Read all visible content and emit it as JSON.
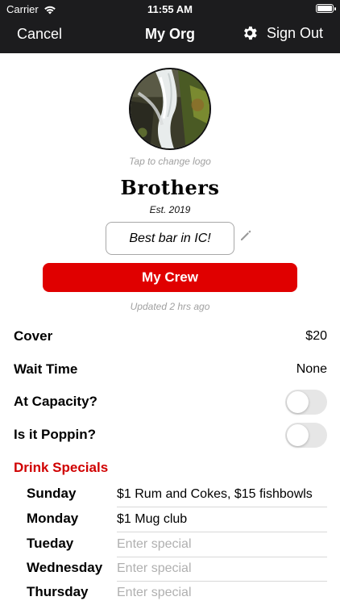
{
  "status_bar": {
    "carrier": "Carrier",
    "time": "11:55 AM"
  },
  "nav": {
    "cancel": "Cancel",
    "title": "My Org",
    "sign_out": "Sign Out"
  },
  "profile": {
    "logo_hint": "Tap to change logo",
    "name": "Brothers",
    "established": "Est. 2019",
    "tagline": "Best bar in IC!",
    "crew_button": "My Crew",
    "updated": "Updated 2 hrs ago"
  },
  "details": [
    {
      "label": "Cover",
      "value": "$20"
    },
    {
      "label": "Wait Time",
      "value": "None"
    }
  ],
  "toggles": [
    {
      "label": "At Capacity?",
      "on": false
    },
    {
      "label": "Is it Poppin?",
      "on": false
    }
  ],
  "drink_specials": {
    "title": "Drink Specials",
    "placeholder": "Enter special",
    "days": [
      {
        "day": "Sunday",
        "special": "$1 Rum and Cokes, $15 fishbowls"
      },
      {
        "day": "Monday",
        "special": "$1 Mug club"
      },
      {
        "day": "Tueday",
        "special": ""
      },
      {
        "day": "Wednesday",
        "special": ""
      },
      {
        "day": "Thursday",
        "special": ""
      }
    ]
  },
  "colors": {
    "nav_bg": "#1c1c1e",
    "accent_red": "#e00000",
    "section_red": "#d00000"
  }
}
